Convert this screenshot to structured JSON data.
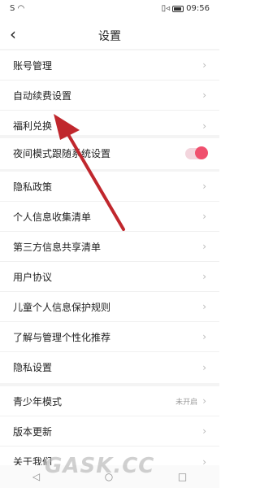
{
  "status_bar": {
    "time": "09:56",
    "left_icons": "S ◠",
    "right_icons": "▯◃"
  },
  "header": {
    "title": "设置",
    "back_glyph": "‹"
  },
  "group1": [
    {
      "label": "账号管理"
    },
    {
      "label": "自动续费设置"
    },
    {
      "label": "福利兑换"
    }
  ],
  "night_mode": {
    "label": "夜间模式跟随系统设置",
    "on": true
  },
  "group3": [
    {
      "label": "隐私政策"
    },
    {
      "label": "个人信息收集清单"
    },
    {
      "label": "第三方信息共享清单"
    },
    {
      "label": "用户协议"
    },
    {
      "label": "儿童个人信息保护规则"
    },
    {
      "label": "了解与管理个性化推荐"
    },
    {
      "label": "隐私设置"
    }
  ],
  "group4": [
    {
      "label": "青少年模式",
      "status": "未开启"
    },
    {
      "label": "版本更新"
    },
    {
      "label": "关于我们"
    }
  ],
  "chevron": "›",
  "navbar": {
    "back": "◁",
    "home": "○",
    "recent": "□"
  },
  "watermark": "GASK.CC",
  "colors": {
    "toggle_on": "#f0506e",
    "arrow": "#c0272d"
  }
}
